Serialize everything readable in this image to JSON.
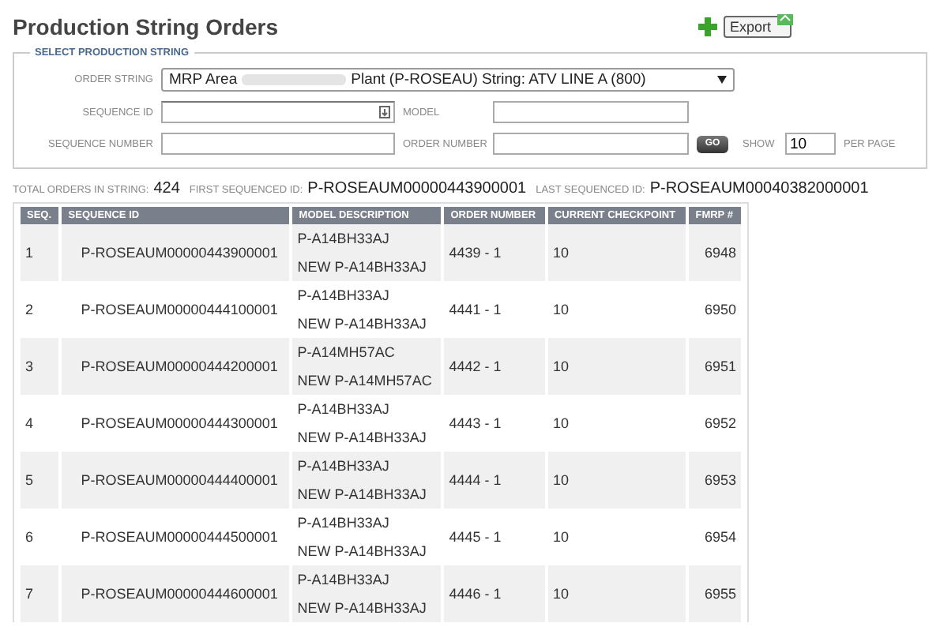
{
  "page": {
    "title": "Production String Orders"
  },
  "toolbar": {
    "export_label": "Export"
  },
  "filters": {
    "legend": "SELECT PRODUCTION STRING",
    "order_string": {
      "label": "ORDER STRING",
      "value_start": "MRP Area",
      "value_end": "Plant (P-ROSEAU) String: ATV LINE A (800)"
    },
    "sequence_id": {
      "label": "SEQUENCE ID"
    },
    "model": {
      "label": "MODEL"
    },
    "sequence_number": {
      "label": "SEQUENCE NUMBER"
    },
    "order_number": {
      "label": "ORDER NUMBER"
    },
    "go_label": "GO",
    "show_label": "SHOW",
    "per_page_value": "10",
    "per_page_label": "PER PAGE"
  },
  "summary": [
    {
      "label": "TOTAL ORDERS IN STRING:",
      "value": "424"
    },
    {
      "label": "FIRST SEQUENCED ID:",
      "value": "P-ROSEAUM00000443900001"
    },
    {
      "label": "LAST SEQUENCED ID:",
      "value": "P-ROSEAUM00040382000001"
    }
  ],
  "table": {
    "columns": [
      "SEQ.",
      "SEQUENCE ID",
      "MODEL DESCRIPTION",
      "ORDER NUMBER",
      "CURRENT CHECKPOINT",
      "FMRP #"
    ],
    "rows": [
      {
        "seq": "1",
        "sequence_id": "P-ROSEAUM00000443900001",
        "model": "P-A14BH33AJ",
        "model_new": "NEW P-A14BH33AJ",
        "order_number": "4439 - 1",
        "checkpoint": "10",
        "fmrp": "6948"
      },
      {
        "seq": "2",
        "sequence_id": "P-ROSEAUM00000444100001",
        "model": "P-A14BH33AJ",
        "model_new": "NEW P-A14BH33AJ",
        "order_number": "4441 - 1",
        "checkpoint": "10",
        "fmrp": "6950"
      },
      {
        "seq": "3",
        "sequence_id": "P-ROSEAUM00000444200001",
        "model": "P-A14MH57AC",
        "model_new": "NEW P-A14MH57AC",
        "order_number": "4442 - 1",
        "checkpoint": "10",
        "fmrp": "6951"
      },
      {
        "seq": "4",
        "sequence_id": "P-ROSEAUM00000444300001",
        "model": "P-A14BH33AJ",
        "model_new": "NEW P-A14BH33AJ",
        "order_number": "4443 - 1",
        "checkpoint": "10",
        "fmrp": "6952"
      },
      {
        "seq": "5",
        "sequence_id": "P-ROSEAUM00000444400001",
        "model": "P-A14BH33AJ",
        "model_new": "NEW P-A14BH33AJ",
        "order_number": "4444 - 1",
        "checkpoint": "10",
        "fmrp": "6953"
      },
      {
        "seq": "6",
        "sequence_id": "P-ROSEAUM00000444500001",
        "model": "P-A14BH33AJ",
        "model_new": "NEW P-A14BH33AJ",
        "order_number": "4445 - 1",
        "checkpoint": "10",
        "fmrp": "6954"
      },
      {
        "seq": "7",
        "sequence_id": "P-ROSEAUM00000444600001",
        "model": "P-A14BH33AJ",
        "model_new": "NEW P-A14BH33AJ",
        "order_number": "4446 - 1",
        "checkpoint": "10",
        "fmrp": "6955"
      }
    ]
  }
}
